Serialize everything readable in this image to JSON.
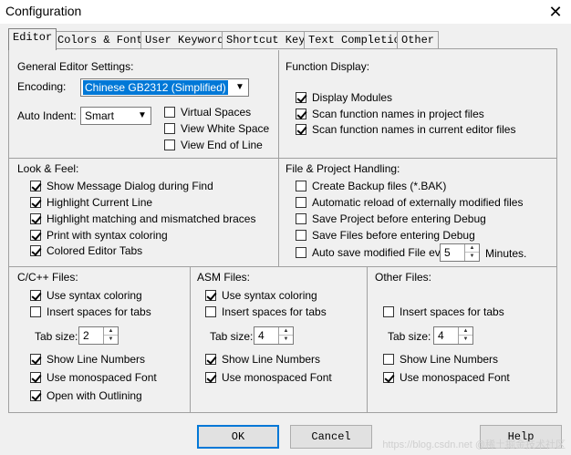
{
  "window": {
    "title": "Configuration",
    "close_glyph": "✕"
  },
  "tabs": [
    {
      "label": "Editor",
      "active": true
    },
    {
      "label": "Colors & Fonts"
    },
    {
      "label": "User Keywords"
    },
    {
      "label": "Shortcut Keys"
    },
    {
      "label": "Text Completion"
    },
    {
      "label": "Other"
    }
  ],
  "general": {
    "heading": "General Editor Settings:",
    "encoding_label": "Encoding:",
    "encoding_value": "Chinese GB2312 (Simplified)",
    "auto_indent_label": "Auto Indent:",
    "auto_indent_value": "Smart",
    "virtual_spaces": "Virtual Spaces",
    "view_white_space": "View White Space",
    "view_end_of_line": "View End of Line"
  },
  "function_display": {
    "heading": "Function Display:",
    "items": [
      "Display Modules",
      "Scan function names in project files",
      "Scan function names in current editor files"
    ]
  },
  "look_feel": {
    "heading": "Look & Feel:",
    "items": [
      "Show Message Dialog during Find",
      "Highlight Current Line",
      "Highlight matching and mismatched braces",
      "Print with syntax coloring",
      "Colored Editor Tabs"
    ]
  },
  "file_project": {
    "heading": "File & Project Handling:",
    "items": [
      "Create Backup files (*.BAK)",
      "Automatic reload of externally modified files",
      "Save Project before entering Debug",
      "Save Files before entering Debug",
      "Auto save modified File every"
    ],
    "minutes_value": "5",
    "minutes_label": "Minutes."
  },
  "cpp_files": {
    "heading": "C/C++ Files:",
    "use_syntax": "Use syntax coloring",
    "insert_spaces": "Insert spaces for tabs",
    "tab_size_label": "Tab size:",
    "tab_size": "2",
    "show_line_numbers": "Show Line Numbers",
    "monospaced": "Use monospaced Font",
    "outlining": "Open with Outlining"
  },
  "asm_files": {
    "heading": "ASM Files:",
    "use_syntax": "Use syntax coloring",
    "insert_spaces": "Insert spaces for tabs",
    "tab_size_label": "Tab size:",
    "tab_size": "4",
    "show_line_numbers": "Show Line Numbers",
    "monospaced": "Use monospaced Font"
  },
  "other_files": {
    "heading": "Other Files:",
    "insert_spaces": "Insert spaces for tabs",
    "tab_size_label": "Tab size:",
    "tab_size": "4",
    "show_line_numbers": "Show Line Numbers",
    "monospaced": "Use monospaced Font"
  },
  "buttons": {
    "ok": "OK",
    "cancel": "Cancel",
    "help": "Help"
  },
  "watermark": "https://blog.csdn.net  @稀土掘金技术社区"
}
